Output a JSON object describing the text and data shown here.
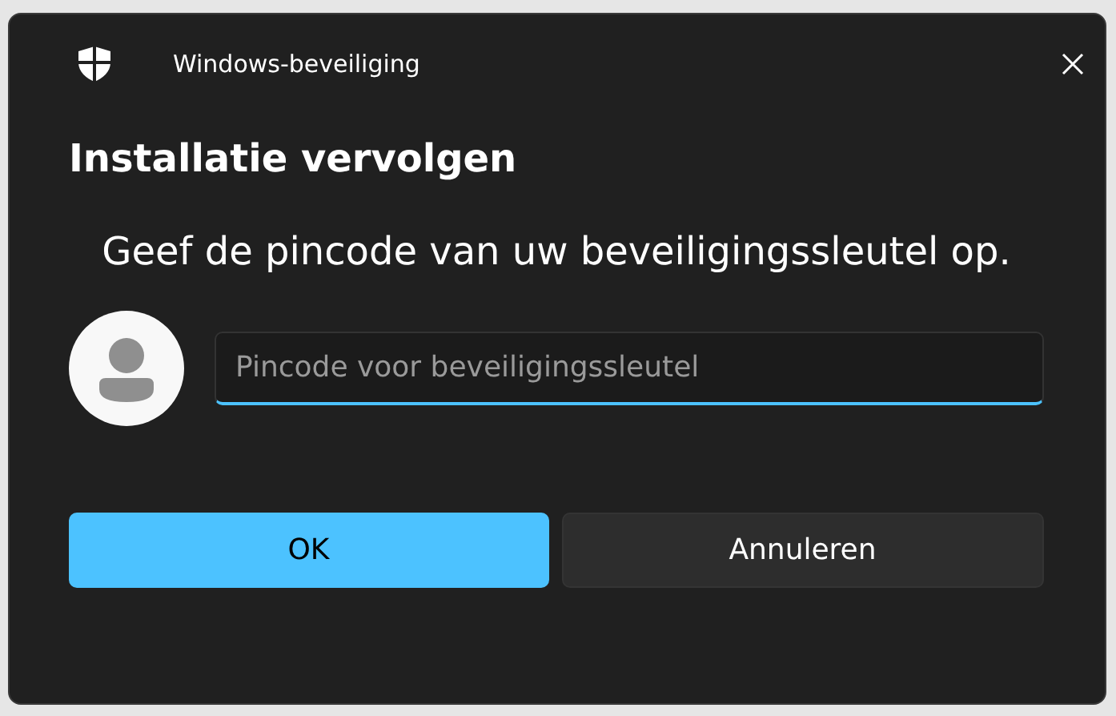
{
  "window": {
    "title": "Windows-beveiliging"
  },
  "heading": "Installatie vervolgen",
  "message": "Geef de pincode van uw beveiligingssleutel op.",
  "pin_field": {
    "placeholder": "Pincode voor beveiligingssleutel"
  },
  "buttons": [
    {
      "label": "OK",
      "kind": "primary"
    },
    {
      "label": "Annuleren",
      "kind": "secondary"
    }
  ]
}
